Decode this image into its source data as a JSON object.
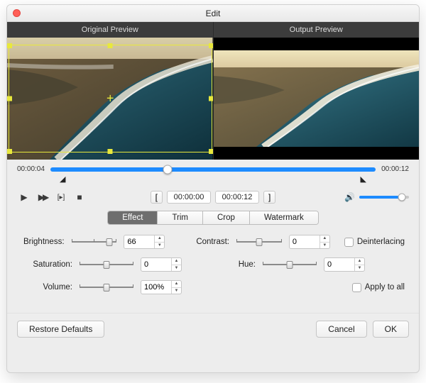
{
  "window": {
    "title": "Edit"
  },
  "previews": {
    "original_label": "Original Preview",
    "output_label": "Output Preview"
  },
  "timeline": {
    "start": "00:00:04",
    "end": "00:00:12",
    "progress_pct": 36
  },
  "transport": {
    "range_start": "00:00:00",
    "range_end": "00:00:12",
    "volume_pct": 85
  },
  "tabs": {
    "effect": "Effect",
    "trim": "Trim",
    "crop": "Crop",
    "watermark": "Watermark",
    "active": "effect"
  },
  "effect": {
    "brightness": {
      "label": "Brightness:",
      "value": "66",
      "pos_pct": 83
    },
    "contrast": {
      "label": "Contrast:",
      "value": "0",
      "pos_pct": 50
    },
    "saturation": {
      "label": "Saturation:",
      "value": "0",
      "pos_pct": 50
    },
    "hue": {
      "label": "Hue:",
      "value": "0",
      "pos_pct": 50
    },
    "volume": {
      "label": "Volume:",
      "value": "100%",
      "pos_pct": 50
    },
    "deinterlacing": {
      "label": "Deinterlacing",
      "checked": false
    },
    "apply_all": {
      "label": "Apply to all",
      "checked": false
    }
  },
  "footer": {
    "restore": "Restore Defaults",
    "cancel": "Cancel",
    "ok": "OK"
  },
  "colors": {
    "accent": "#1d8bff",
    "crop": "#e8e83c"
  }
}
